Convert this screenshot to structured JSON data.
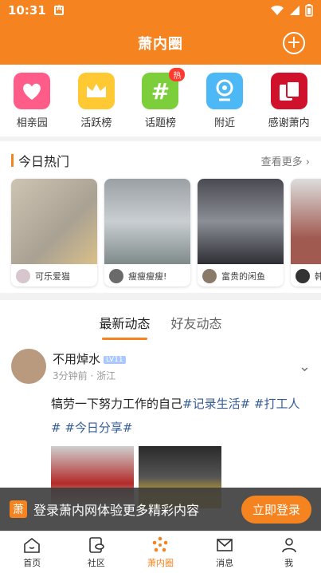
{
  "status": {
    "time": "10:31"
  },
  "header": {
    "title": "萧内圈"
  },
  "quick": [
    {
      "label": "相亲园"
    },
    {
      "label": "活跃榜"
    },
    {
      "label": "话题榜",
      "badge": "热"
    },
    {
      "label": "附近"
    },
    {
      "label": "感谢萧内"
    }
  ],
  "today": {
    "title": "今日热门",
    "more": "查看更多",
    "cards": [
      {
        "name": "可乐爱猫"
      },
      {
        "name": "瘦瘦瘦瘦!"
      },
      {
        "name": "富贵的闲鱼"
      },
      {
        "name": "韩"
      }
    ]
  },
  "feed": {
    "tabs": [
      "最新动态",
      "好友动态"
    ],
    "post": {
      "name": "不用焯水",
      "level": "LV11",
      "meta": "3分钟前 · 浙江",
      "text": "犒劳一下努力工作的自己",
      "tags": "#记录生活# #打工人",
      "tags2": "# #今日分享#"
    }
  },
  "login": {
    "text": "登录萧内网体验更多精彩内容",
    "button": "立即登录",
    "logo": "萧"
  },
  "tabbar": [
    "首页",
    "社区",
    "萧内圈",
    "消息",
    "我"
  ]
}
